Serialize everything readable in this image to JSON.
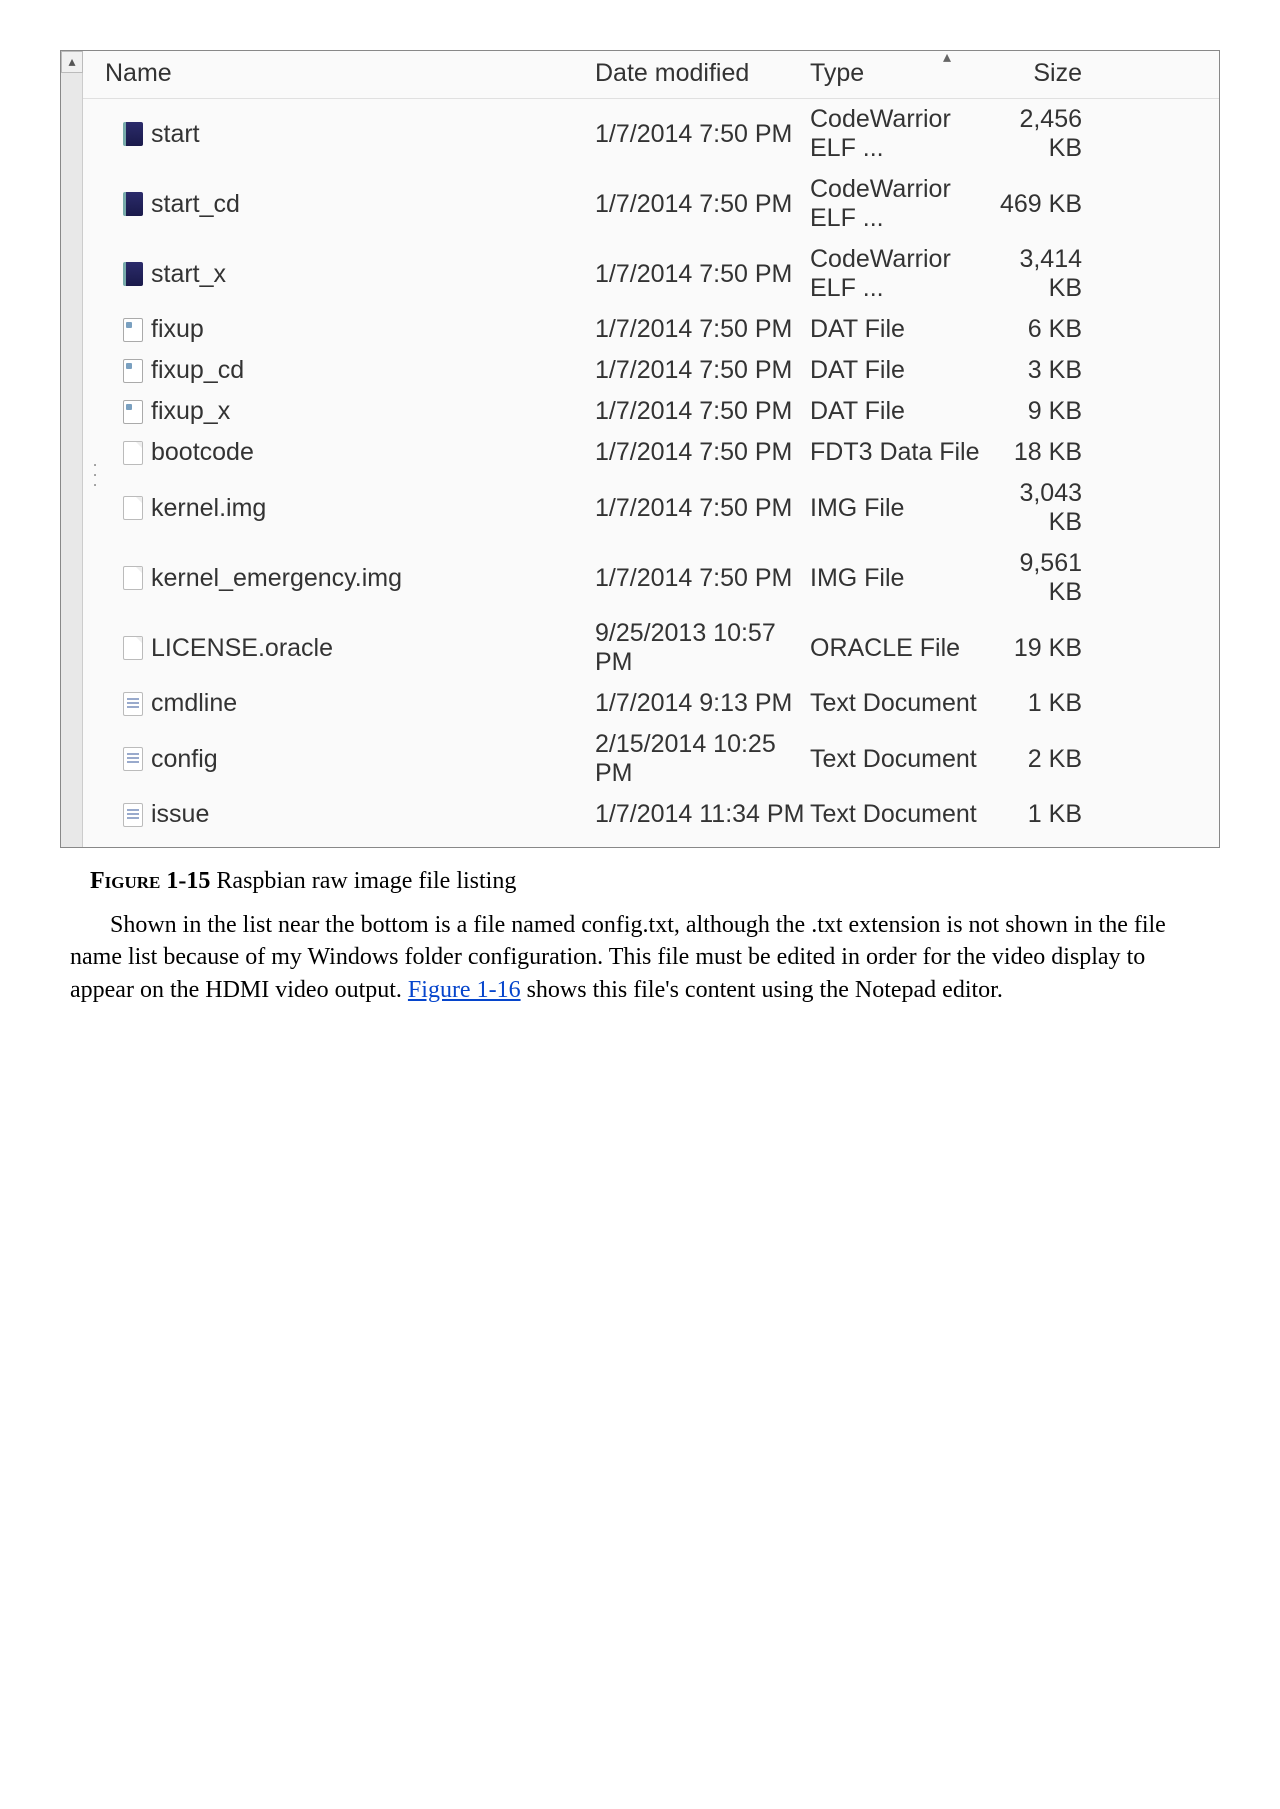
{
  "columns": {
    "name": "Name",
    "date": "Date modified",
    "type": "Type",
    "size": "Size"
  },
  "files": [
    {
      "icon": "elf",
      "name": "start",
      "date": "1/7/2014 7:50 PM",
      "type": "CodeWarrior ELF ...",
      "size": "2,456 KB"
    },
    {
      "icon": "elf",
      "name": "start_cd",
      "date": "1/7/2014 7:50 PM",
      "type": "CodeWarrior ELF ...",
      "size": "469 KB"
    },
    {
      "icon": "elf",
      "name": "start_x",
      "date": "1/7/2014 7:50 PM",
      "type": "CodeWarrior ELF ...",
      "size": "3,414 KB"
    },
    {
      "icon": "dat",
      "name": "fixup",
      "date": "1/7/2014 7:50 PM",
      "type": "DAT File",
      "size": "6 KB"
    },
    {
      "icon": "dat",
      "name": "fixup_cd",
      "date": "1/7/2014 7:50 PM",
      "type": "DAT File",
      "size": "3 KB"
    },
    {
      "icon": "dat",
      "name": "fixup_x",
      "date": "1/7/2014 7:50 PM",
      "type": "DAT File",
      "size": "9 KB"
    },
    {
      "icon": "file",
      "name": "bootcode",
      "date": "1/7/2014 7:50 PM",
      "type": "FDT3 Data File",
      "size": "18 KB"
    },
    {
      "icon": "file",
      "name": "kernel.img",
      "date": "1/7/2014 7:50 PM",
      "type": "IMG File",
      "size": "3,043 KB"
    },
    {
      "icon": "file",
      "name": "kernel_emergency.img",
      "date": "1/7/2014 7:50 PM",
      "type": "IMG File",
      "size": "9,561 KB"
    },
    {
      "icon": "file",
      "name": "LICENSE.oracle",
      "date": "9/25/2013 10:57 PM",
      "type": "ORACLE File",
      "size": "19 KB"
    },
    {
      "icon": "txt",
      "name": "cmdline",
      "date": "1/7/2014 9:13 PM",
      "type": "Text Document",
      "size": "1 KB"
    },
    {
      "icon": "txt",
      "name": "config",
      "date": "2/15/2014 10:25 PM",
      "type": "Text Document",
      "size": "2 KB"
    },
    {
      "icon": "txt",
      "name": "issue",
      "date": "1/7/2014 11:34 PM",
      "type": "Text Document",
      "size": "1 KB"
    }
  ],
  "caption": {
    "label_prefix": "Figure",
    "label_number": "1-15",
    "text": "Raspbian raw image file listing"
  },
  "paragraph": {
    "part1": "Shown in the list near the bottom is a file named config.txt, although the .txt extension is not shown in the file name list because of my Windows folder configuration. This file must be edited in order for the video display to appear on the HDMI video output. ",
    "link_text": "Figure 1-16",
    "part2": " shows this file's content using the Notepad editor."
  }
}
